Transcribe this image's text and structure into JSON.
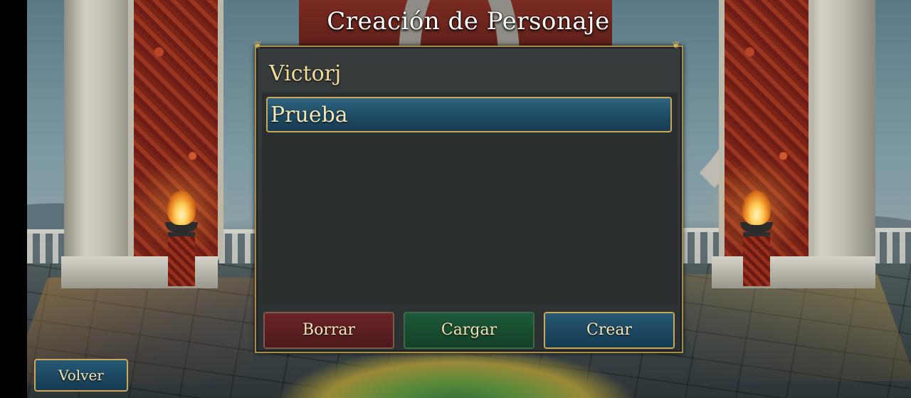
{
  "screen": {
    "title": "Creación de Personaje"
  },
  "panel": {
    "account_name": "Victorj",
    "characters": [
      {
        "name": "Prueba",
        "selected": true
      }
    ]
  },
  "actions": {
    "delete_label": "Borrar",
    "load_label": "Cargar",
    "create_label": "Crear"
  },
  "navigation": {
    "back_label": "Volver"
  },
  "colors": {
    "title_text": "#ffffff",
    "panel_gold_text": "#f2dc9c",
    "gold_border": "#c9a85a",
    "delete_button": "#6a2327",
    "load_button": "#1d5a3a",
    "create_button": "#255874",
    "selected_item": "#2e6580"
  }
}
